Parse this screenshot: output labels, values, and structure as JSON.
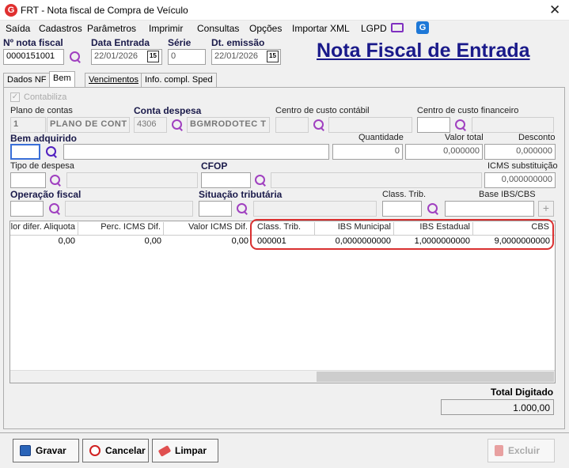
{
  "window": {
    "title": "FRT - Nota fiscal de Compra de Veículo",
    "icon_letter": "G",
    "close_symbol": "✕"
  },
  "menu": [
    "Saída",
    "Cadastros",
    "Parâmetros",
    "Imprimir",
    "Consultas",
    "Opções",
    "Importar XML",
    "LGPD"
  ],
  "header": {
    "nota_label": "Nº nota fiscal",
    "nota_value": "0000151001",
    "entrada_label": "Data Entrada",
    "entrada_value": "22/01/2026",
    "serie_label": "Série",
    "serie_value": "0",
    "emissao_label": "Dt. emissão",
    "emissao_value": "22/01/2026",
    "calendar_text": "15",
    "big_title": "Nota Fiscal de Entrada"
  },
  "tabs": [
    "Dados NF",
    "Bem",
    "Vencimentos",
    "Info. compl. Sped"
  ],
  "form": {
    "contabiliza": "Contabiliza",
    "plano_label": "Plano de contas",
    "plano_code": "1",
    "plano_name": "PLANO DE CONT",
    "despesa_label": "Conta despesa",
    "despesa_code": "4306",
    "despesa_name": "BGMRODOTEC T",
    "cc_contabil_label": "Centro de custo contábil",
    "cc_financeiro_label": "Centro de custo financeiro",
    "bem_label": "Bem adquirido",
    "qtd_label": "Quantidade",
    "qtd_value": "0",
    "valor_total_label": "Valor total",
    "valor_total_value": "0,000000",
    "desconto_label": "Desconto",
    "desconto_value": "0,000000",
    "tipo_despesa_label": "Tipo de despesa",
    "cfop_label": "CFOP",
    "icms_subst_label": "ICMS substituição",
    "icms_subst_value": "0,000000000",
    "operacao_label": "Operação fiscal",
    "situacao_label": "Situação tributária",
    "class_trib_label": "Class. Trib.",
    "base_ibs_label": "Base IBS/CBS",
    "plus_symbol": "+"
  },
  "grid": {
    "headers": [
      "lor difer. Aliquota",
      "Perc. ICMS Dif.",
      "Valor ICMS Dif.",
      "Class. Trib.",
      "IBS Municipal",
      "IBS Estadual",
      "CBS"
    ],
    "rows": [
      [
        "0,00",
        "0,00",
        "0,00",
        "000001",
        "0,0000000000",
        "1,0000000000",
        "9,0000000000"
      ]
    ]
  },
  "totals": {
    "label": "Total Digitado",
    "value": "1.000,00"
  },
  "buttons": {
    "gravar": "Gravar",
    "cancelar": "Cancelar",
    "limpar": "Limpar",
    "excluir": "Excluir"
  },
  "colors": {
    "title_blue": "#1a1a8a",
    "highlight_red": "#d93030",
    "search_purple": "#a040c0"
  }
}
